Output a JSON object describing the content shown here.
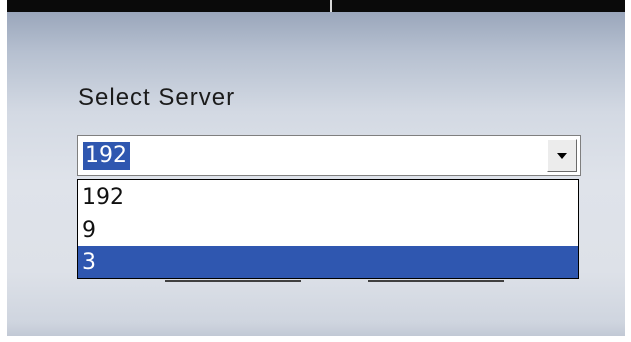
{
  "dialog": {
    "title": "Select Server"
  },
  "server_select": {
    "value": "192",
    "options": [
      {
        "label": "192",
        "selected": false
      },
      {
        "label": "9",
        "selected": false
      },
      {
        "label": "3",
        "selected": true
      }
    ]
  },
  "colors": {
    "selection": "#2f57b0",
    "frame": "#0a0a0a"
  },
  "icons": {
    "dropdown_arrow": "chevron-down-icon"
  }
}
